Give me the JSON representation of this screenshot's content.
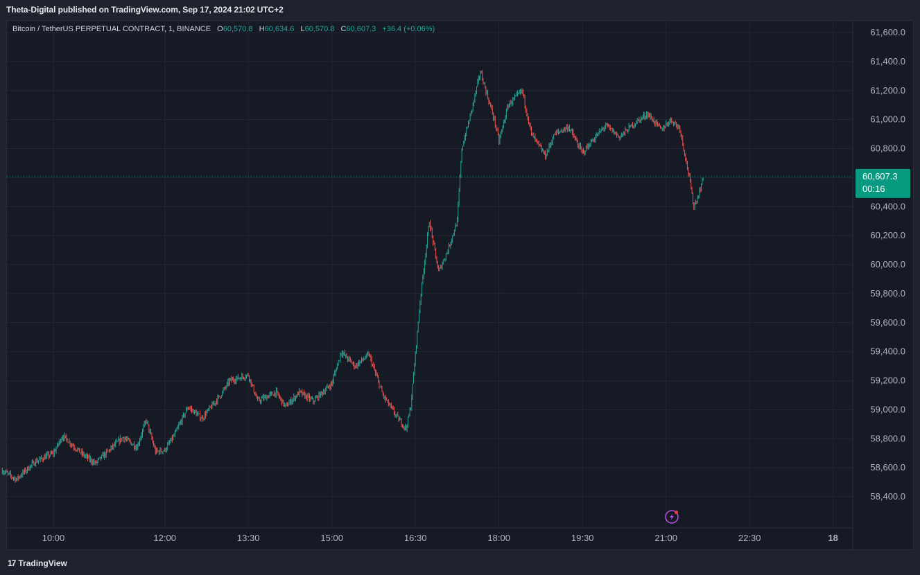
{
  "header": {
    "publisher_line": "Theta-Digital published on TradingView.com, Sep 17, 2024 21:02 UTC+2"
  },
  "legend": {
    "symbol": "Bitcoin / TetherUS PERPETUAL CONTRACT, 1, BINANCE",
    "open_label": "O",
    "open": "60,570.8",
    "high_label": "H",
    "high": "60,634.6",
    "low_label": "L",
    "low": "60,570.8",
    "close_label": "C",
    "close": "60,607.3",
    "change": "+36.4 (+0.06%)"
  },
  "price_badge": {
    "price": "60,607.3",
    "countdown": "00:16",
    "color": "#089981"
  },
  "footer": {
    "brand": "TradingView",
    "logo_glyph": "17"
  },
  "colors": {
    "up": "#26a69a",
    "down": "#ef5350",
    "grid": "#242733",
    "background": "#161a25",
    "alert": "#b84be0"
  },
  "icons": [
    "alert-bolt-icon",
    "tradingview-logo-icon"
  ],
  "chart_data": {
    "type": "candlestick",
    "symbol": "BTCUSDT.P",
    "interval": "1 minute",
    "x_ticks": [
      "10:00",
      "12:00",
      "13:30",
      "15:00",
      "16:30",
      "18:00",
      "19:30",
      "21:00",
      "22:30",
      "18"
    ],
    "y_ticks": [
      "58,400.0",
      "58,600.0",
      "58,800.0",
      "59,000.0",
      "59,200.0",
      "59,400.0",
      "59,600.0",
      "59,800.0",
      "60,000.0",
      "60,200.0",
      "60,400.0",
      "60,600.0",
      "60,800.0",
      "61,000.0",
      "61,200.0",
      "61,400.0",
      "61,600.0"
    ],
    "ylim": [
      58300,
      61700
    ],
    "grid": true,
    "last_price": 60607.3,
    "price_path": [
      [
        "09:05",
        58580
      ],
      [
        "09:20",
        58520
      ],
      [
        "09:40",
        58640
      ],
      [
        "10:00",
        58700
      ],
      [
        "10:10",
        58820
      ],
      [
        "10:30",
        58700
      ],
      [
        "10:45",
        58630
      ],
      [
        "11:00",
        58720
      ],
      [
        "11:15",
        58810
      ],
      [
        "11:30",
        58740
      ],
      [
        "11:40",
        58930
      ],
      [
        "11:50",
        58710
      ],
      [
        "12:00",
        58720
      ],
      [
        "12:10",
        58820
      ],
      [
        "12:25",
        59020
      ],
      [
        "12:40",
        58940
      ],
      [
        "13:00",
        59100
      ],
      [
        "13:10",
        59200
      ],
      [
        "13:30",
        59240
      ],
      [
        "13:40",
        59060
      ],
      [
        "14:00",
        59120
      ],
      [
        "14:10",
        59020
      ],
      [
        "14:25",
        59120
      ],
      [
        "14:40",
        59060
      ],
      [
        "15:00",
        59180
      ],
      [
        "15:10",
        59400
      ],
      [
        "15:25",
        59300
      ],
      [
        "15:40",
        59380
      ],
      [
        "15:55",
        59100
      ],
      [
        "16:10",
        58950
      ],
      [
        "16:20",
        58870
      ],
      [
        "16:25",
        59020
      ],
      [
        "16:35",
        59750
      ],
      [
        "16:45",
        60300
      ],
      [
        "16:55",
        59950
      ],
      [
        "17:05",
        60100
      ],
      [
        "17:15",
        60300
      ],
      [
        "17:20",
        60800
      ],
      [
        "17:30",
        61050
      ],
      [
        "17:40",
        61330
      ],
      [
        "17:55",
        61000
      ],
      [
        "18:00",
        60850
      ],
      [
        "18:10",
        61100
      ],
      [
        "18:25",
        61200
      ],
      [
        "18:35",
        60900
      ],
      [
        "18:50",
        60750
      ],
      [
        "19:00",
        60900
      ],
      [
        "19:15",
        60950
      ],
      [
        "19:30",
        60770
      ],
      [
        "19:40",
        60850
      ],
      [
        "19:55",
        60960
      ],
      [
        "20:10",
        60880
      ],
      [
        "20:25",
        60970
      ],
      [
        "20:40",
        61040
      ],
      [
        "20:55",
        60930
      ],
      [
        "21:05",
        61000
      ],
      [
        "21:15",
        60940
      ],
      [
        "21:25",
        60600
      ],
      [
        "21:30",
        60400
      ],
      [
        "21:35",
        60480
      ],
      [
        "21:40",
        60600
      ]
    ]
  }
}
